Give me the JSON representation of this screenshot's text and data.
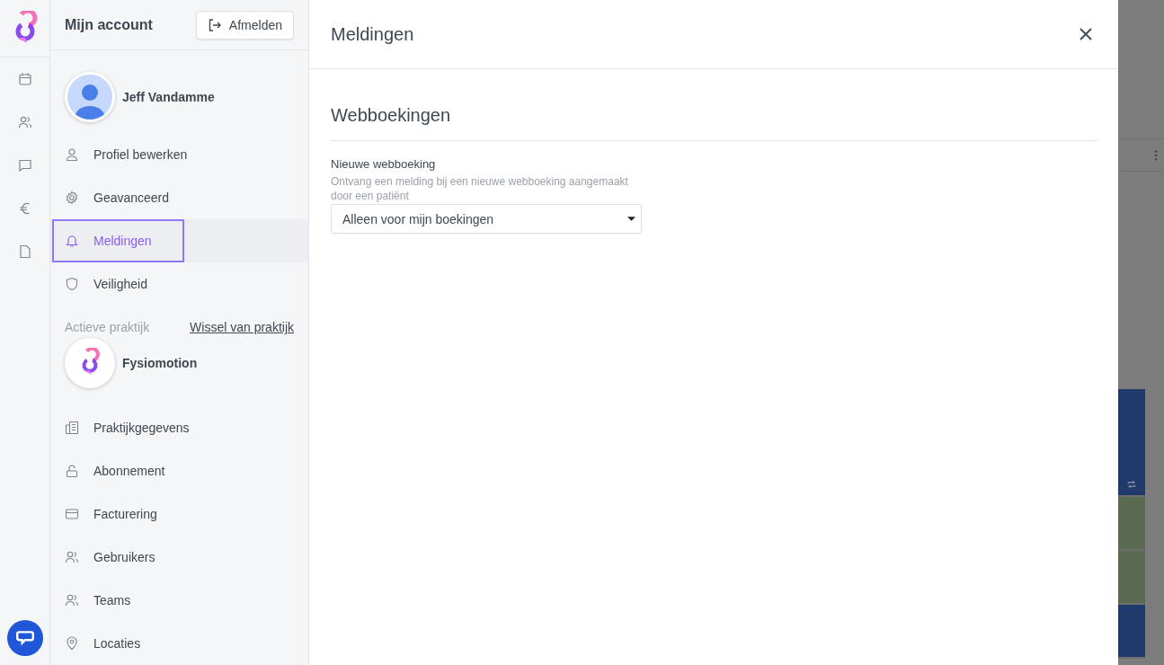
{
  "panel": {
    "title": "Mijn account",
    "logout_button": "Afmelden",
    "user": {
      "name": "Jeff Vandamme"
    },
    "account_items": [
      {
        "label": "Profiel bewerken",
        "kind": "person",
        "selected": false
      },
      {
        "label": "Geavanceerd",
        "kind": "gear",
        "selected": false
      },
      {
        "label": "Meldingen",
        "kind": "bell",
        "selected": true
      },
      {
        "label": "Veiligheid",
        "kind": "shield",
        "selected": false
      }
    ],
    "practice_label": "Actieve praktijk",
    "switch_link": "Wissel van praktijk",
    "practice": {
      "name": "Fysiomotion"
    },
    "practice_items": [
      {
        "label": "Praktijkgegevens",
        "kind": "building",
        "selected": false
      },
      {
        "label": "Abonnement",
        "kind": "lock",
        "selected": false
      },
      {
        "label": "Facturering",
        "kind": "card",
        "selected": false
      },
      {
        "label": "Gebruikers",
        "kind": "users",
        "selected": false
      },
      {
        "label": "Teams",
        "kind": "users",
        "selected": false
      },
      {
        "label": "Locaties",
        "kind": "pin",
        "selected": false
      }
    ]
  },
  "modal": {
    "title": "Meldingen",
    "section": "Webboekingen",
    "field": {
      "label": "Nieuwe webboeking",
      "help": "Ontvang een melding bij een nieuwe webboeking aangemaakt door een patiënt",
      "value": "Alleen voor mijn boekingen"
    }
  }
}
